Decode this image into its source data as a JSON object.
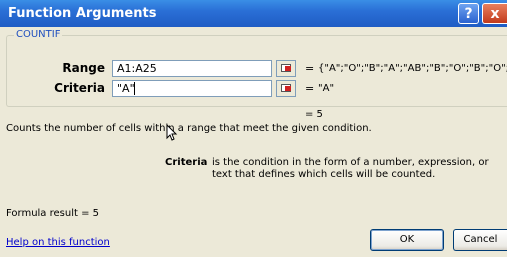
{
  "dialog": {
    "title": "Function Arguments",
    "help_glyph": "?",
    "close_glyph": "x"
  },
  "function": {
    "name": "COUNTIF",
    "args": [
      {
        "label": "Range",
        "value": "A1:A25",
        "result": "{\"A\";\"O\";\"B\";\"A\";\"AB\";\"B\";\"O\";\"B\";\"O\";\"A"
      },
      {
        "label": "Criteria",
        "value": "\"A\"",
        "result": "\"A\""
      }
    ],
    "equals": "=",
    "overall_result": "= 5",
    "description": "Counts the number of cells within a range that meet the given condition.",
    "criteria_label": "Criteria",
    "criteria_desc": "is the condition in the form of a number, expression, or text that defines which cells will be counted."
  },
  "footer": {
    "formula_result": "Formula result =  5",
    "help_link": "Help on this function",
    "ok_label": "OK",
    "cancel_label": "Cancel"
  },
  "icons": {
    "help": "help-icon",
    "close": "close-icon",
    "collapse": "collapse-dialog-icon",
    "cursor": "mouse-cursor-icon"
  }
}
